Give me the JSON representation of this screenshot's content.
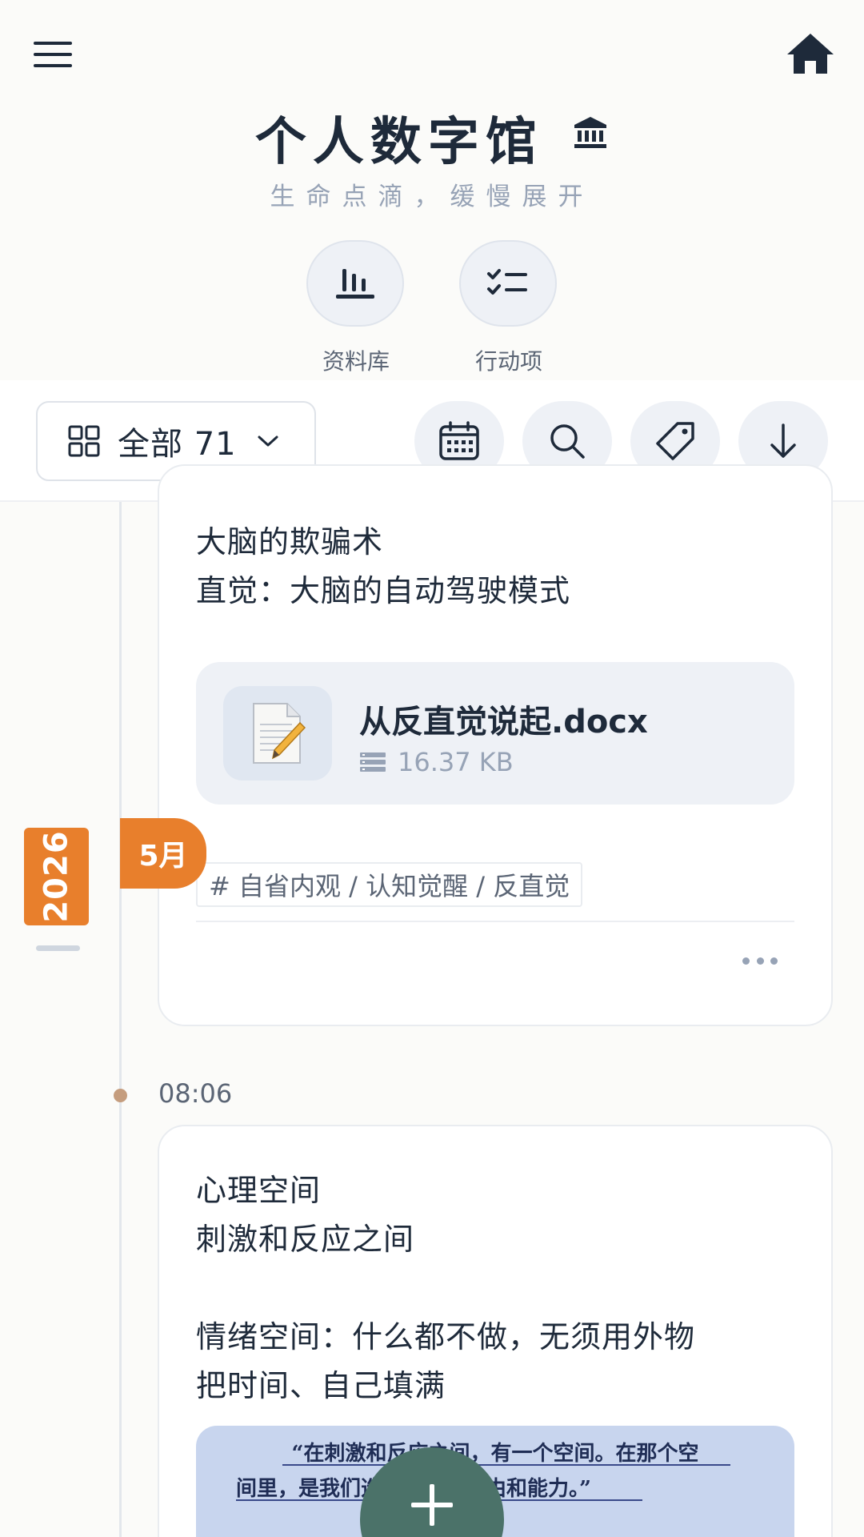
{
  "header": {
    "title": "个人数字馆",
    "subtitle": "生命点滴，缓慢展开",
    "menu_icon": "hamburger-menu-icon",
    "home_icon": "home-icon",
    "title_icon": "museum-icon"
  },
  "quick_actions": [
    {
      "label": "资料库",
      "icon": "library-icon"
    },
    {
      "label": "行动项",
      "icon": "checklist-icon"
    }
  ],
  "toolbar": {
    "filter_label": "全部 71",
    "filter_icon": "grid-icon",
    "tools": [
      "calendar-icon",
      "search-icon",
      "tag-icon",
      "download-arrow-icon"
    ]
  },
  "timeline": {
    "year": "2026",
    "month": "5月"
  },
  "entries": [
    {
      "lines": [
        "大脑的欺骗术",
        "直觉：大脑的自动驾驶模式"
      ],
      "attachment": {
        "name": "从反直觉说起.docx",
        "size": "16.37 KB"
      },
      "tag": "# 自省内观 / 认知觉醒 / 反直觉"
    },
    {
      "time": "08:06",
      "lines": [
        "心理空间",
        "刺激和反应之间",
        "情绪空间：什么都不做，无须用外物",
        "把时间、自己填满"
      ],
      "image_quote": {
        "line1": "“在刺激和反应之间，有一个空间。在那个空",
        "line2": "间里，是我们选择回应的自由和能力。”"
      }
    }
  ],
  "colors": {
    "accent": "#e87f2c",
    "fab": "#4b7269",
    "text": "#1e2a3a",
    "muted": "#97a3b6"
  }
}
